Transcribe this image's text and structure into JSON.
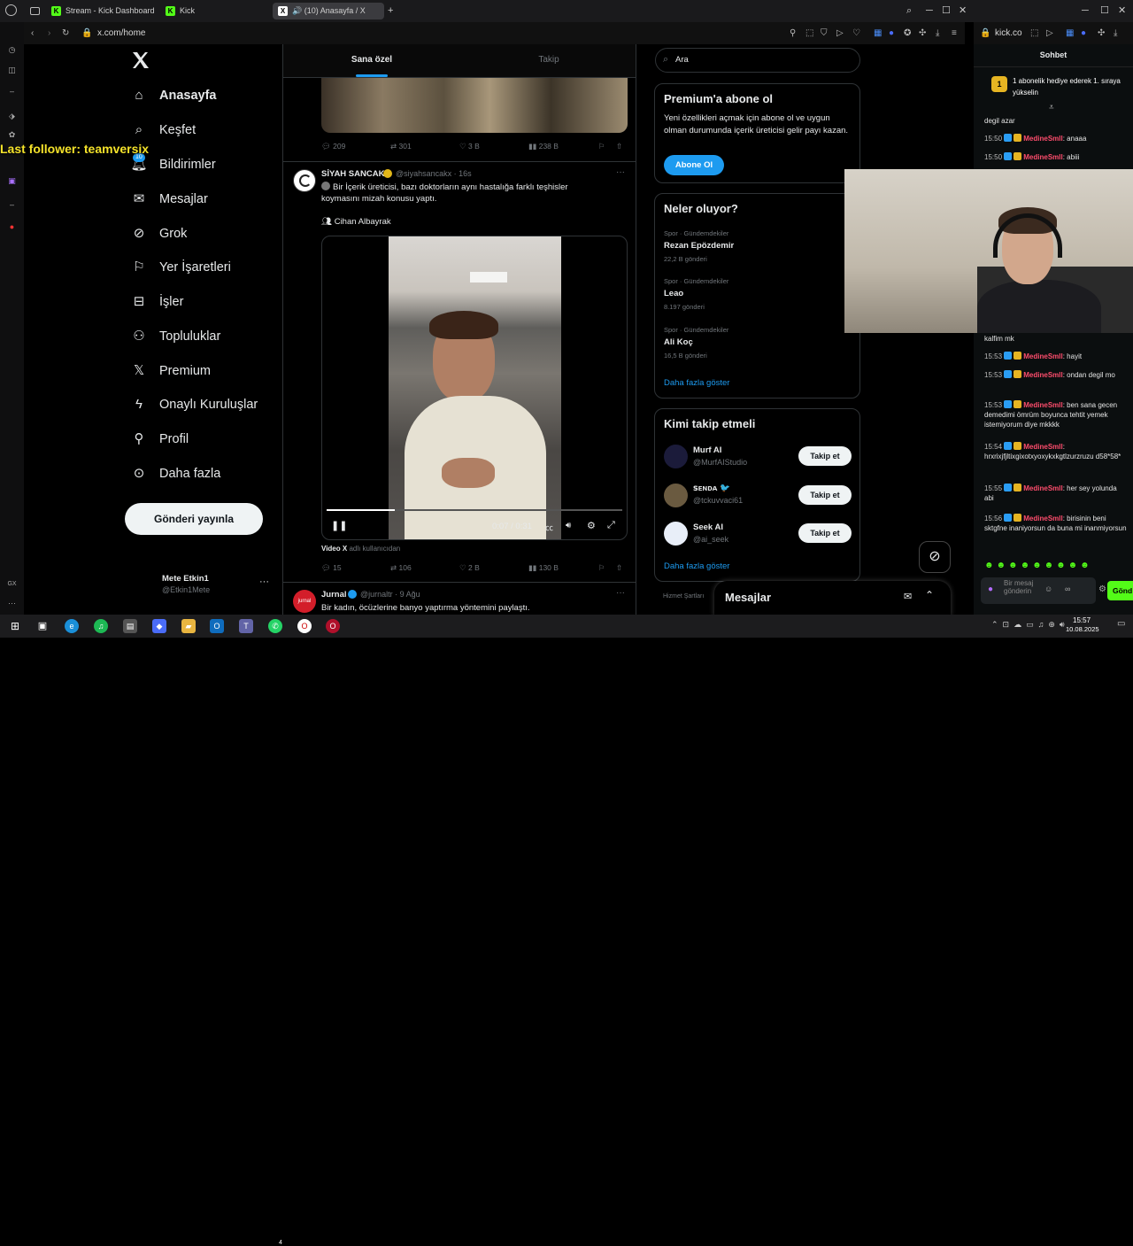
{
  "tabs": [
    {
      "label": "Stream - Kick Dashboard",
      "icon": "kick-icon"
    },
    {
      "label": "Kick",
      "icon": "kick-icon"
    },
    {
      "label": "(10) Anasayfa / X",
      "icon": "x-icon"
    }
  ],
  "address": {
    "left": "x.com/home",
    "right": "kick.co"
  },
  "overlay": {
    "last_follower": "Last follower: teamversix"
  },
  "nav": {
    "items": [
      {
        "label": "Anasayfa",
        "icon": "home-icon"
      },
      {
        "label": "Keşfet",
        "icon": "search-icon"
      },
      {
        "label": "Bildirimler",
        "icon": "bell-icon",
        "badge": "10"
      },
      {
        "label": "Mesajlar",
        "icon": "mail-icon"
      },
      {
        "label": "Grok",
        "icon": "grok-icon"
      },
      {
        "label": "Yer İşaretleri",
        "icon": "bookmark-icon"
      },
      {
        "label": "İşler",
        "icon": "briefcase-icon"
      },
      {
        "label": "Topluluklar",
        "icon": "people-icon"
      },
      {
        "label": "Premium",
        "icon": "x-icon"
      },
      {
        "label": "Onaylı Kuruluşlar",
        "icon": "lightning-icon"
      },
      {
        "label": "Profil",
        "icon": "person-icon"
      },
      {
        "label": "Daha fazla",
        "icon": "more-circle-icon"
      }
    ],
    "post_button": "Gönderi yayınla",
    "account_name": "Mete Etkin1",
    "account_handle": "@Etkin1Mete",
    "more": "···"
  },
  "feed": {
    "tabs": [
      "Sana özel",
      "Takip"
    ],
    "post0_actions": {
      "replies": "209",
      "reposts": "301",
      "likes": "3 B",
      "views": "238 B"
    },
    "post1": {
      "name": "SİYAH SANCAK",
      "handle": "@siyahsancakx · 16s",
      "text": "Bir İçerik üreticisi, bazı doktorların aynı hastalığa farklı teşhisler koymasını mizah konusu yaptı.",
      "mention": "Cihan Albayrak",
      "video_time": "0:07 / 0:31",
      "video_from_bold": "Video X",
      "video_from": "adlı kullanıcıdan",
      "progress": 0.23,
      "actions": {
        "replies": "15",
        "reposts": "106",
        "likes": "2 B",
        "views": "130 B"
      }
    },
    "post2": {
      "name": "Jurnal",
      "handle": "@jurnaltr · 9 Ağu",
      "text": "Bir kadın, öcüzlerine banyo yaptırma yöntemini paylaştı.",
      "avatar_text": "jurnal"
    }
  },
  "right": {
    "search_placeholder": "Ara",
    "premium": {
      "title": "Premium'a abone ol",
      "text": "Yeni özellikleri açmak için abone ol ve uygun olman durumunda içerik üreticisi gelir payı kazan.",
      "button": "Abone Ol"
    },
    "trends": {
      "title": "Neler oluyor?",
      "items": [
        {
          "category": "Spor · Gündemdekiler",
          "name": "Rezan Epözdemir",
          "count": "22,2 B gönderi"
        },
        {
          "category": "Spor · Gündemdekiler",
          "name": "Leao",
          "count": "8.197 gönderi"
        },
        {
          "category": "Spor · Gündemdekiler",
          "name": "Ali Koç",
          "count": "16,5 B gönderi"
        }
      ],
      "more": "Daha fazla göster"
    },
    "who_to_follow": {
      "title": "Kimi takip etmeli",
      "items": [
        {
          "name": "Murf AI",
          "handle": "@MurfAIStudio",
          "button": "Takip et"
        },
        {
          "name": "ꜱᴇɴᴅᴀ 🐦",
          "handle": "@tckuvvaci61",
          "button": "Takip et"
        },
        {
          "name": "Seek AI",
          "handle": "@ai_seek",
          "button": "Takip et"
        }
      ],
      "more": "Daha fazla göster"
    },
    "footer": "Hizmet Şartları",
    "messages_drawer": "Mesajlar"
  },
  "chat": {
    "title": "Sohbet",
    "pinned": "1 abonelik hediye ederek 1. sıraya yükselin",
    "pinned_rank": "1",
    "lines": [
      {
        "text": "degil azar"
      },
      {
        "time": "15:50",
        "user": "MedineSmll",
        "msg": "anaaa"
      },
      {
        "time": "15:50",
        "user": "MedineSmll",
        "msg": "abiii"
      },
      {
        "text": "kalfim mk"
      },
      {
        "time": "15:53",
        "user": "MedineSmll",
        "msg": "hayit"
      },
      {
        "time": "15:53",
        "user": "MedineSmll",
        "msg": "ondan degil mo"
      },
      {
        "time": "15:53",
        "user": "MedineSmll",
        "msg": "ben sana gecen demedimi ömrüm boyunca tehtit yemek istemiyorum diye mkkkk"
      },
      {
        "time": "15:54",
        "user": "MedineSmll",
        "msg": "hrxrixjfjltixgixotxyoxykxkgtlzurzruzu d58*58*"
      },
      {
        "time": "15:55",
        "user": "MedineSmll",
        "msg": "her sey yolunda abi"
      },
      {
        "time": "15:56",
        "user": "MedineSmll",
        "msg": "birisinin beni sktgfne inaniyorsun da buna mi inanmiyorsun"
      }
    ],
    "input_placeholder": "Bir mesaj gönderin",
    "send": "Gönd"
  },
  "taskbar": {
    "time": "15:57",
    "date": "10.08.2025",
    "badge": "4"
  },
  "colors": {
    "kick_green": "#53fc18",
    "x_blue": "#1d9bf0",
    "chat_user": "#ff4d6d",
    "overlay_yellow": "#f4e22a"
  }
}
